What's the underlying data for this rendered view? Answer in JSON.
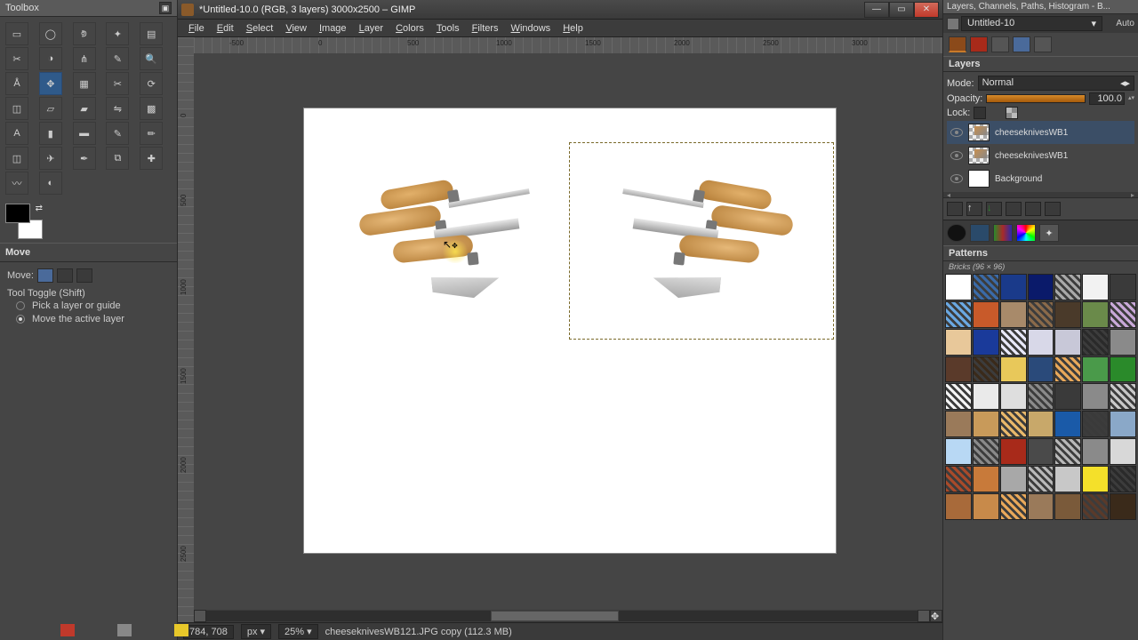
{
  "toolbox": {
    "title": "Toolbox",
    "tools": [
      "rect-select",
      "ellipse-select",
      "free-select",
      "fuzzy-select",
      "color-select",
      "scissors",
      "foreground-select",
      "paths",
      "color-picker",
      "zoom",
      "measure",
      "move",
      "align",
      "crop",
      "rotate",
      "scale",
      "shear",
      "perspective",
      "flip",
      "cage",
      "text",
      "bucket-fill",
      "blend",
      "pencil",
      "paintbrush",
      "eraser",
      "airbrush",
      "ink",
      "clone",
      "heal",
      "smudge",
      "dodge-burn",
      ""
    ],
    "active_tool": "move",
    "options_title": "Move",
    "move_label": "Move:",
    "toggle_label": "Tool Toggle  (Shift)",
    "radio1": "Pick a layer or guide",
    "radio2": "Move the active layer"
  },
  "window": {
    "title": "*Untitled-10.0 (RGB, 3 layers) 3000x2500 – GIMP",
    "min": "—",
    "max": "▭",
    "close": "✕"
  },
  "menu": [
    "File",
    "Edit",
    "Select",
    "View",
    "Image",
    "Layer",
    "Colors",
    "Tools",
    "Filters",
    "Windows",
    "Help"
  ],
  "ruler_h": [
    "-500",
    "0",
    "500",
    "1000",
    "1500",
    "2000",
    "2500",
    "3000"
  ],
  "ruler_v": [
    "0",
    "500",
    "1000",
    "1500",
    "2000",
    "2500"
  ],
  "status": {
    "coords": "784, 708",
    "unit": "px",
    "zoom": "25%",
    "layer_info": "cheeseknivesWB121.JPG copy (112.3 MB)"
  },
  "dock": {
    "title": "Layers, Channels, Paths, Histogram - B...",
    "tab_label": "Untitled-10",
    "auto": "Auto",
    "layers_title": "Layers",
    "mode_label": "Mode:",
    "mode_value": "Normal",
    "opacity_label": "Opacity:",
    "opacity_value": "100.0",
    "lock_label": "Lock:",
    "layers": [
      {
        "name": "cheeseknivesWB1",
        "thumb": "trans"
      },
      {
        "name": "cheeseknivesWB1",
        "thumb": "trans"
      },
      {
        "name": "Background",
        "thumb": "white"
      }
    ],
    "patterns_title": "Patterns",
    "patterns_sub": "Bricks (96 × 96)",
    "swatches": [
      "#ffffff",
      "#3a6aa8",
      "#1a3a8a",
      "#0a1a6a",
      "#a8a8a8",
      "#f2f2f2",
      "#3a3a3a",
      "#6aa8e2",
      "#c85a2a",
      "#a88a6a",
      "#8a6a4a",
      "#4a3a2a",
      "#6a8a4a",
      "#c8a8d8",
      "#e8c89a",
      "#1a3a9a",
      "#e8e8f8",
      "#d8d8e8",
      "#c8c8d8",
      "#2a2a2a",
      "#8a8a8a",
      "#5a3a2a",
      "#3a2a1a",
      "#e8c85a",
      "#2a4a7a",
      "#e8a85a",
      "#4a9a4a",
      "#2a8a2a",
      "#f4f4f4",
      "#eaeaea",
      "#dedede",
      "#8a8a8a",
      "#3a3a3a",
      "#8a8a8a",
      "#c8c8c8",
      "#9a7a5a",
      "#c89a5a",
      "#e8b86a",
      "#c8a86a",
      "#1a5aa8",
      "#3a3a3a",
      "#8aa8c8",
      "#b8d8f4",
      "#8a8a8a",
      "#a82a1a",
      "#4a4a4a",
      "#b8b8b8",
      "#8a8a8a",
      "#d8d8d8",
      "#a84a2a",
      "#c87a3a",
      "#a8a8a8",
      "#b8b8b8",
      "#c8c8c8",
      "#f4e02a",
      "#2a2a2a",
      "#a86a3a",
      "#c88a4a",
      "#e8a85a",
      "#9a7a5a",
      "#7a5a3a",
      "#5a3a2a",
      "#3a2a1a"
    ]
  }
}
